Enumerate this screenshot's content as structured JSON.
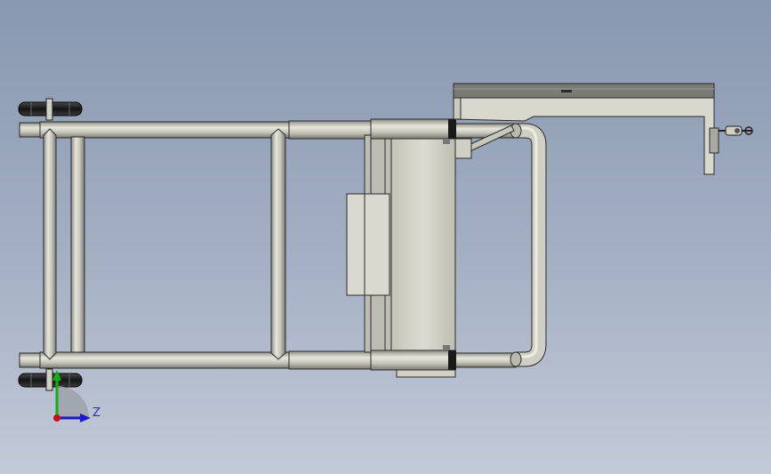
{
  "viewport": {
    "background_top": "#8898b0",
    "background_bottom": "#c3cad8"
  },
  "model": {
    "tube_color": "#c9c9bd",
    "tube_edge": "#2b2b2b",
    "plate_color": "#d6d6cc",
    "handle_bar_color": "#7a7a74",
    "wheel_color": "#1e1e1e"
  },
  "triad": {
    "axis_z_label": "Z",
    "axis_z_color": "#1a1acc",
    "axis_y_color": "#10b010",
    "origin_color": "#cc1010"
  }
}
